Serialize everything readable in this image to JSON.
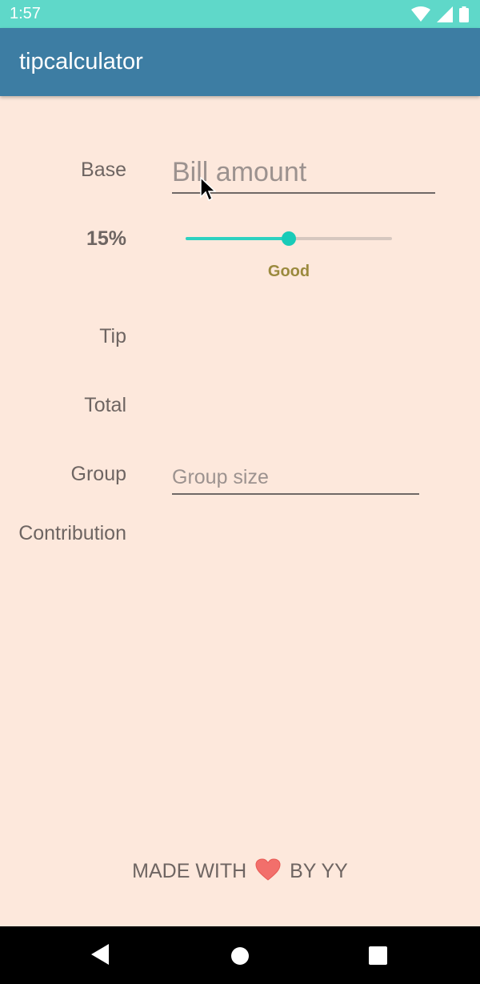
{
  "status_bar": {
    "time": "1:57",
    "icons": [
      "wifi-icon",
      "cell-signal-icon",
      "battery-icon"
    ]
  },
  "app_bar": {
    "title": "tipcalculator"
  },
  "form": {
    "base_label": "Base",
    "bill_placeholder": "Bill amount",
    "tip_percent_label": "15%",
    "tip_percent_value": 15,
    "tip_percent_max": 30,
    "tip_description": "Good",
    "tip_label": "Tip",
    "total_label": "Total",
    "group_label": "Group",
    "group_placeholder": "Group size",
    "contribution_label": "Contribution"
  },
  "footer": {
    "made_with": "MADE WITH",
    "by": "BY YY",
    "heart_icon": "heart-icon"
  },
  "colors": {
    "status_bar": "#5fd8c9",
    "app_bar": "#3d7da3",
    "background": "#fde8dc",
    "accent": "#19cbb8",
    "tip_description": "#9b8a3e"
  },
  "nav_bar": {
    "buttons": [
      "back-icon",
      "home-icon",
      "recents-icon"
    ]
  }
}
